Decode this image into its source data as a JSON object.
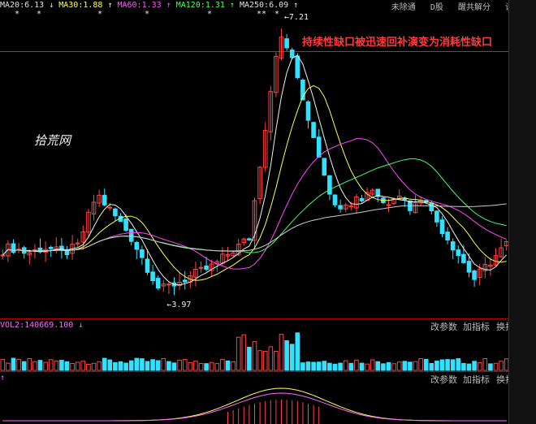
{
  "chart_data": {
    "type": "candlestick",
    "indicators": {
      "ma_labels": [
        {
          "text": "MA20:6.13",
          "arrow": "↓",
          "color": "#e0e0e0"
        },
        {
          "text": "MA30:1.88",
          "arrow": "↑",
          "color": "#ffff55"
        },
        {
          "text": "MA60:1.33",
          "arrow": "↑",
          "color": "#ff55ff"
        },
        {
          "text": "MA120:1.31",
          "arrow": "↑",
          "color": "#55ff55"
        },
        {
          "text": "MA250:6.09",
          "arrow": "↑",
          "color": "#e0e0e0"
        }
      ],
      "vol_label": "VOL2:140669.100",
      "vol_arrow": "↓"
    },
    "annotations": {
      "high_price": "7.21",
      "low_price": "3.97",
      "note": "持续性缺口被迅速回补演变为消耗性缺口",
      "watermark": "拾荒网",
      "markers": [
        "*",
        "*",
        "*",
        "*",
        "*",
        "**",
        "*"
      ]
    },
    "toolbar": [
      "未除通",
      "D股",
      "醒共解分",
      "设置"
    ],
    "panel_buttons": {
      "params": "改参数",
      "add_indicator": "加指标",
      "switch": "换指"
    },
    "colors": {
      "up": "#ff4444",
      "down": "#33e0ff",
      "ma_white": "#f0f0f0",
      "ma_yellow": "#ffff55",
      "ma_magenta": "#ff44ff",
      "ma_green": "#44ff66",
      "ma_gray": "#cccccc"
    }
  }
}
